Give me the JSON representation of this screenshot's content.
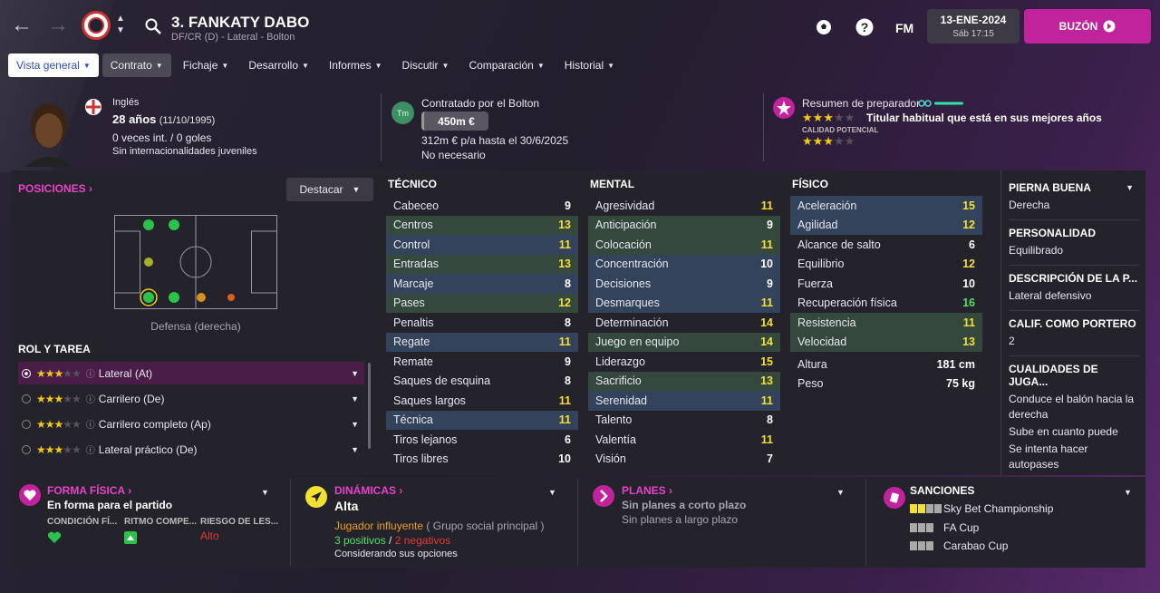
{
  "header": {
    "player_title": "3. FANKATY DABO",
    "player_subtitle": "DF/CR (D) - Lateral - Bolton",
    "fm_label": "FM",
    "date": "13-ENE-2024",
    "time": "Sáb 17:15",
    "buzon": "BUZÓN"
  },
  "tabs": [
    {
      "label": "Vista general"
    },
    {
      "label": "Contrato"
    },
    {
      "label": "Fichaje"
    },
    {
      "label": "Desarrollo"
    },
    {
      "label": "Informes"
    },
    {
      "label": "Discutir"
    },
    {
      "label": "Comparación"
    },
    {
      "label": "Historial"
    }
  ],
  "bio": {
    "nationality": "Inglés",
    "age": "28 años",
    "dob": "(11/10/1995)",
    "caps": "0 veces int. / 0 goles",
    "youth": "Sin internacionalidades juveniles"
  },
  "contract": {
    "club": "Contratado por el Bolton",
    "badge": "Tm",
    "value": "450m €",
    "wage": "312m € p/a hasta el 30/6/2025",
    "status": "No necesario"
  },
  "coach": {
    "label": "Resumen de preparador",
    "summary": "Titular habitual que está en sus mejores años",
    "potential_label": "CALIDAD POTENCIAL",
    "current_stars": 3,
    "potential_stars": 3
  },
  "positions": {
    "title": "POSICIONES",
    "highlight_button": "Destacar",
    "position_label": "Defensa (derecha)"
  },
  "roles": {
    "title": "ROL Y TAREA",
    "items": [
      {
        "label": "Lateral (At)",
        "stars": 3
      },
      {
        "label": "Carrilero (De)",
        "stars": 3
      },
      {
        "label": "Carrilero completo (Ap)",
        "stars": 3
      },
      {
        "label": "Lateral práctico (De)",
        "stars": 3
      }
    ]
  },
  "tecnico": {
    "title": "TÉCNICO",
    "rows": [
      {
        "name": "Cabeceo",
        "value": "9",
        "hl": "",
        "color": "w"
      },
      {
        "name": "Centros",
        "value": "13",
        "hl": "g",
        "color": "y"
      },
      {
        "name": "Control",
        "value": "11",
        "hl": "b",
        "color": "y"
      },
      {
        "name": "Entradas",
        "value": "13",
        "hl": "g",
        "color": "y"
      },
      {
        "name": "Marcaje",
        "value": "8",
        "hl": "b",
        "color": "w"
      },
      {
        "name": "Pases",
        "value": "12",
        "hl": "g",
        "color": "y"
      },
      {
        "name": "Penaltis",
        "value": "8",
        "hl": "",
        "color": "w"
      },
      {
        "name": "Regate",
        "value": "11",
        "hl": "b",
        "color": "y"
      },
      {
        "name": "Remate",
        "value": "9",
        "hl": "",
        "color": "w"
      },
      {
        "name": "Saques de esquina",
        "value": "8",
        "hl": "",
        "color": "w"
      },
      {
        "name": "Saques largos",
        "value": "11",
        "hl": "",
        "color": "y"
      },
      {
        "name": "Técnica",
        "value": "11",
        "hl": "b",
        "color": "y"
      },
      {
        "name": "Tiros lejanos",
        "value": "6",
        "hl": "",
        "color": "w"
      },
      {
        "name": "Tiros libres",
        "value": "10",
        "hl": "",
        "color": "w"
      }
    ]
  },
  "mental": {
    "title": "MENTAL",
    "rows": [
      {
        "name": "Agresividad",
        "value": "11",
        "hl": "",
        "color": "y"
      },
      {
        "name": "Anticipación",
        "value": "9",
        "hl": "g",
        "color": "w"
      },
      {
        "name": "Colocación",
        "value": "11",
        "hl": "g",
        "color": "y"
      },
      {
        "name": "Concentración",
        "value": "10",
        "hl": "b",
        "color": "w"
      },
      {
        "name": "Decisiones",
        "value": "9",
        "hl": "b",
        "color": "w"
      },
      {
        "name": "Desmarques",
        "value": "11",
        "hl": "b",
        "color": "y"
      },
      {
        "name": "Determinación",
        "value": "14",
        "hl": "",
        "color": "y"
      },
      {
        "name": "Juego en equipo",
        "value": "14",
        "hl": "g",
        "color": "y"
      },
      {
        "name": "Liderazgo",
        "value": "15",
        "hl": "",
        "color": "y"
      },
      {
        "name": "Sacrificio",
        "value": "13",
        "hl": "g",
        "color": "y"
      },
      {
        "name": "Serenidad",
        "value": "11",
        "hl": "b",
        "color": "y"
      },
      {
        "name": "Talento",
        "value": "8",
        "hl": "",
        "color": "w"
      },
      {
        "name": "Valentía",
        "value": "11",
        "hl": "",
        "color": "y"
      },
      {
        "name": "Visión",
        "value": "7",
        "hl": "",
        "color": "w"
      }
    ]
  },
  "fisico": {
    "title": "FÍSICO",
    "rows": [
      {
        "name": "Aceleración",
        "value": "15",
        "hl": "b",
        "color": "y"
      },
      {
        "name": "Agilidad",
        "value": "12",
        "hl": "b",
        "color": "y"
      },
      {
        "name": "Alcance de salto",
        "value": "6",
        "hl": "",
        "color": "w"
      },
      {
        "name": "Equilibrio",
        "value": "12",
        "hl": "",
        "color": "y"
      },
      {
        "name": "Fuerza",
        "value": "10",
        "hl": "",
        "color": "w"
      },
      {
        "name": "Recuperación física",
        "value": "16",
        "hl": "",
        "color": "gr"
      },
      {
        "name": "Resistencia",
        "value": "11",
        "hl": "g",
        "color": "y"
      },
      {
        "name": "Velocidad",
        "value": "13",
        "hl": "g",
        "color": "y"
      }
    ],
    "height_label": "Altura",
    "height": "181 cm",
    "weight_label": "Peso",
    "weight": "75 kg"
  },
  "details": [
    {
      "label": "PIERNA BUENA",
      "value": "Derecha"
    },
    {
      "label": "PERSONALIDAD",
      "value": "Equilibrado"
    },
    {
      "label": "DESCRIPCIÓN DE LA P...",
      "value": "Lateral defensivo"
    },
    {
      "label": "CALIF. COMO PORTERO",
      "value": "2"
    },
    {
      "label": "CUALIDADES DE JUGA...",
      "values": [
        "Conduce el balón hacia la derecha",
        "Sube en cuanto puede",
        "Se intenta hacer autopases"
      ]
    }
  ],
  "forma": {
    "title": "FORMA FÍSICA",
    "status": "En forma para el partido",
    "col1": "CONDICIÓN FÍ...",
    "col2": "RITMO COMPE...",
    "col3": "RIESGO DE LES...",
    "risk": "Alto"
  },
  "dinamicas": {
    "title": "DINÁMICAS",
    "level": "Alta",
    "influence": "Jugador influyente",
    "group": "( Grupo social principal )",
    "positives": "3 positivos",
    "separator": "/",
    "negatives": "2 negativos",
    "considering": "Considerando sus opciones"
  },
  "planes": {
    "title": "PLANES",
    "short": "Sin planes a corto plazo",
    "long": "Sin planes a largo plazo"
  },
  "sanciones": {
    "title": "SANCIONES",
    "items": [
      "Sky Bet Championship",
      "FA Cup",
      "Carabao Cup"
    ]
  },
  "colors": {
    "accent": "#c0239c",
    "pink": "#e842c8",
    "yellow": "#f2e033",
    "green": "#4fe067"
  }
}
